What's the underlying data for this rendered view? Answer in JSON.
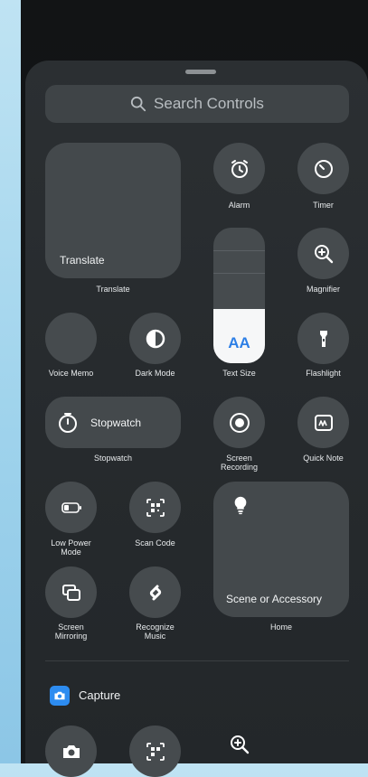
{
  "search": {
    "placeholder": "Search Controls"
  },
  "controls": {
    "translate": {
      "title": "Translate",
      "label": "Translate"
    },
    "alarm": {
      "label": "Alarm"
    },
    "timer": {
      "label": "Timer"
    },
    "magnifier": {
      "label": "Magnifier"
    },
    "voice_memo": {
      "label": "Voice Memo"
    },
    "dark_mode": {
      "label": "Dark Mode"
    },
    "text_size": {
      "label": "Text Size",
      "glyph": "AA",
      "level": 0.4
    },
    "flashlight": {
      "label": "Flashlight"
    },
    "stopwatch": {
      "title": "Stopwatch",
      "label": "Stopwatch"
    },
    "screen_recording": {
      "label": "Screen\nRecording"
    },
    "quick_note": {
      "label": "Quick Note"
    },
    "low_power": {
      "label": "Low Power\nMode"
    },
    "scan_code": {
      "label": "Scan Code"
    },
    "home": {
      "title": "Scene or Accessory",
      "label": "Home"
    },
    "screen_mirroring": {
      "label": "Screen\nMirroring"
    },
    "recognize_music": {
      "label": "Recognize\nMusic"
    }
  },
  "capture": {
    "title": "Capture",
    "accent": "#2d8cf0"
  },
  "icons": [
    "search-icon",
    "alarm-icon",
    "timer-icon",
    "magnifier-icon",
    "contrast-icon",
    "flashlight-icon",
    "stopwatch-icon",
    "record-icon",
    "note-icon",
    "battery-icon",
    "qr-icon",
    "lightbulb-icon",
    "mirroring-icon",
    "shazam-icon",
    "camera-icon"
  ]
}
